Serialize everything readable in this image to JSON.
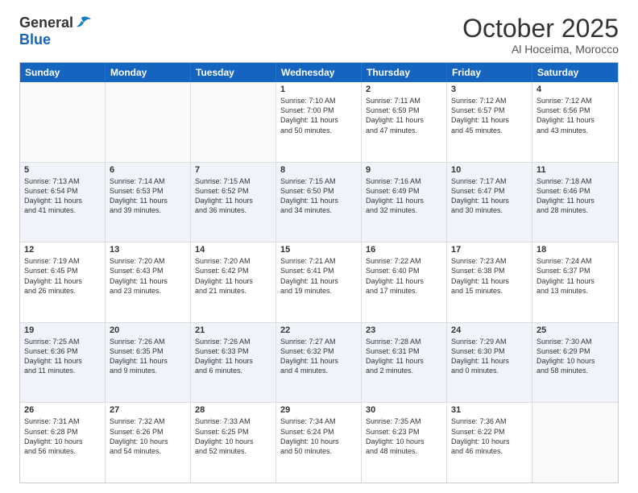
{
  "logo": {
    "general": "General",
    "blue": "Blue"
  },
  "header": {
    "month": "October 2025",
    "location": "Al Hoceima, Morocco"
  },
  "weekdays": [
    "Sunday",
    "Monday",
    "Tuesday",
    "Wednesday",
    "Thursday",
    "Friday",
    "Saturday"
  ],
  "rows": [
    {
      "alt": false,
      "cells": [
        {
          "empty": true,
          "day": "",
          "info": ""
        },
        {
          "empty": true,
          "day": "",
          "info": ""
        },
        {
          "empty": true,
          "day": "",
          "info": ""
        },
        {
          "empty": false,
          "day": "1",
          "info": "Sunrise: 7:10 AM\nSunset: 7:00 PM\nDaylight: 11 hours\nand 50 minutes."
        },
        {
          "empty": false,
          "day": "2",
          "info": "Sunrise: 7:11 AM\nSunset: 6:59 PM\nDaylight: 11 hours\nand 47 minutes."
        },
        {
          "empty": false,
          "day": "3",
          "info": "Sunrise: 7:12 AM\nSunset: 6:57 PM\nDaylight: 11 hours\nand 45 minutes."
        },
        {
          "empty": false,
          "day": "4",
          "info": "Sunrise: 7:12 AM\nSunset: 6:56 PM\nDaylight: 11 hours\nand 43 minutes."
        }
      ]
    },
    {
      "alt": true,
      "cells": [
        {
          "empty": false,
          "day": "5",
          "info": "Sunrise: 7:13 AM\nSunset: 6:54 PM\nDaylight: 11 hours\nand 41 minutes."
        },
        {
          "empty": false,
          "day": "6",
          "info": "Sunrise: 7:14 AM\nSunset: 6:53 PM\nDaylight: 11 hours\nand 39 minutes."
        },
        {
          "empty": false,
          "day": "7",
          "info": "Sunrise: 7:15 AM\nSunset: 6:52 PM\nDaylight: 11 hours\nand 36 minutes."
        },
        {
          "empty": false,
          "day": "8",
          "info": "Sunrise: 7:15 AM\nSunset: 6:50 PM\nDaylight: 11 hours\nand 34 minutes."
        },
        {
          "empty": false,
          "day": "9",
          "info": "Sunrise: 7:16 AM\nSunset: 6:49 PM\nDaylight: 11 hours\nand 32 minutes."
        },
        {
          "empty": false,
          "day": "10",
          "info": "Sunrise: 7:17 AM\nSunset: 6:47 PM\nDaylight: 11 hours\nand 30 minutes."
        },
        {
          "empty": false,
          "day": "11",
          "info": "Sunrise: 7:18 AM\nSunset: 6:46 PM\nDaylight: 11 hours\nand 28 minutes."
        }
      ]
    },
    {
      "alt": false,
      "cells": [
        {
          "empty": false,
          "day": "12",
          "info": "Sunrise: 7:19 AM\nSunset: 6:45 PM\nDaylight: 11 hours\nand 26 minutes."
        },
        {
          "empty": false,
          "day": "13",
          "info": "Sunrise: 7:20 AM\nSunset: 6:43 PM\nDaylight: 11 hours\nand 23 minutes."
        },
        {
          "empty": false,
          "day": "14",
          "info": "Sunrise: 7:20 AM\nSunset: 6:42 PM\nDaylight: 11 hours\nand 21 minutes."
        },
        {
          "empty": false,
          "day": "15",
          "info": "Sunrise: 7:21 AM\nSunset: 6:41 PM\nDaylight: 11 hours\nand 19 minutes."
        },
        {
          "empty": false,
          "day": "16",
          "info": "Sunrise: 7:22 AM\nSunset: 6:40 PM\nDaylight: 11 hours\nand 17 minutes."
        },
        {
          "empty": false,
          "day": "17",
          "info": "Sunrise: 7:23 AM\nSunset: 6:38 PM\nDaylight: 11 hours\nand 15 minutes."
        },
        {
          "empty": false,
          "day": "18",
          "info": "Sunrise: 7:24 AM\nSunset: 6:37 PM\nDaylight: 11 hours\nand 13 minutes."
        }
      ]
    },
    {
      "alt": true,
      "cells": [
        {
          "empty": false,
          "day": "19",
          "info": "Sunrise: 7:25 AM\nSunset: 6:36 PM\nDaylight: 11 hours\nand 11 minutes."
        },
        {
          "empty": false,
          "day": "20",
          "info": "Sunrise: 7:26 AM\nSunset: 6:35 PM\nDaylight: 11 hours\nand 9 minutes."
        },
        {
          "empty": false,
          "day": "21",
          "info": "Sunrise: 7:26 AM\nSunset: 6:33 PM\nDaylight: 11 hours\nand 6 minutes."
        },
        {
          "empty": false,
          "day": "22",
          "info": "Sunrise: 7:27 AM\nSunset: 6:32 PM\nDaylight: 11 hours\nand 4 minutes."
        },
        {
          "empty": false,
          "day": "23",
          "info": "Sunrise: 7:28 AM\nSunset: 6:31 PM\nDaylight: 11 hours\nand 2 minutes."
        },
        {
          "empty": false,
          "day": "24",
          "info": "Sunrise: 7:29 AM\nSunset: 6:30 PM\nDaylight: 11 hours\nand 0 minutes."
        },
        {
          "empty": false,
          "day": "25",
          "info": "Sunrise: 7:30 AM\nSunset: 6:29 PM\nDaylight: 10 hours\nand 58 minutes."
        }
      ]
    },
    {
      "alt": false,
      "cells": [
        {
          "empty": false,
          "day": "26",
          "info": "Sunrise: 7:31 AM\nSunset: 6:28 PM\nDaylight: 10 hours\nand 56 minutes."
        },
        {
          "empty": false,
          "day": "27",
          "info": "Sunrise: 7:32 AM\nSunset: 6:26 PM\nDaylight: 10 hours\nand 54 minutes."
        },
        {
          "empty": false,
          "day": "28",
          "info": "Sunrise: 7:33 AM\nSunset: 6:25 PM\nDaylight: 10 hours\nand 52 minutes."
        },
        {
          "empty": false,
          "day": "29",
          "info": "Sunrise: 7:34 AM\nSunset: 6:24 PM\nDaylight: 10 hours\nand 50 minutes."
        },
        {
          "empty": false,
          "day": "30",
          "info": "Sunrise: 7:35 AM\nSunset: 6:23 PM\nDaylight: 10 hours\nand 48 minutes."
        },
        {
          "empty": false,
          "day": "31",
          "info": "Sunrise: 7:36 AM\nSunset: 6:22 PM\nDaylight: 10 hours\nand 46 minutes."
        },
        {
          "empty": true,
          "day": "",
          "info": ""
        }
      ]
    }
  ]
}
